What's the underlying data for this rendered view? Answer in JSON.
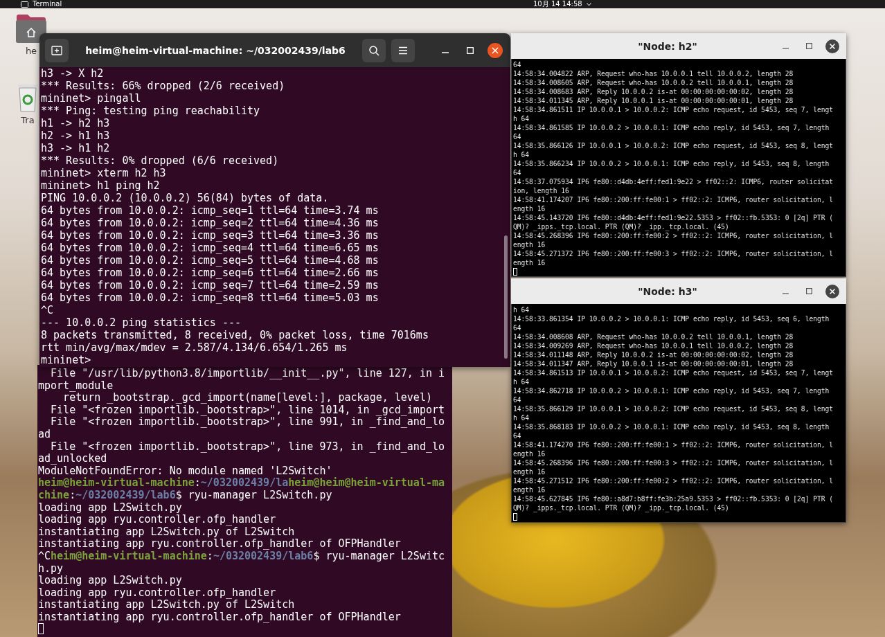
{
  "top_bar": {
    "app_menu": "Terminal",
    "clock": "10月 14 14:58"
  },
  "desktop_icons": [
    {
      "kind": "home",
      "label": "he"
    },
    {
      "kind": "trash",
      "label": "Tra"
    }
  ],
  "main_terminal": {
    "title": "heim@heim-virtual-machine: ~/032002439/lab6",
    "lines": [
      "h3 -> X h2",
      "*** Results: 66% dropped (2/6 received)",
      "mininet> pingall",
      "*** Ping: testing ping reachability",
      "h1 -> h2 h3",
      "h2 -> h1 h3",
      "h3 -> h1 h2",
      "*** Results: 0% dropped (6/6 received)",
      "mininet> xterm h2 h3",
      "mininet> h1 ping h2",
      "PING 10.0.0.2 (10.0.0.2) 56(84) bytes of data.",
      "64 bytes from 10.0.0.2: icmp_seq=1 ttl=64 time=3.74 ms",
      "64 bytes from 10.0.0.2: icmp_seq=2 ttl=64 time=4.36 ms",
      "64 bytes from 10.0.0.2: icmp_seq=3 ttl=64 time=3.36 ms",
      "64 bytes from 10.0.0.2: icmp_seq=4 ttl=64 time=6.65 ms",
      "64 bytes from 10.0.0.2: icmp_seq=5 ttl=64 time=4.68 ms",
      "64 bytes from 10.0.0.2: icmp_seq=6 ttl=64 time=2.66 ms",
      "64 bytes from 10.0.0.2: icmp_seq=7 ttl=64 time=2.59 ms",
      "64 bytes from 10.0.0.2: icmp_seq=8 ttl=64 time=5.03 ms",
      "^C",
      "--- 10.0.0.2 ping statistics ---",
      "8 packets transmitted, 8 received, 0% packet loss, time 7016ms",
      "rtt min/avg/max/mdev = 2.587/4.134/6.654/1.265 ms",
      "mininet>"
    ]
  },
  "back_terminal": {
    "lines": [
      [
        {
          "kind": "text",
          "text": "  File \"/usr/lib/python3.8/importlib/__init__.py\", line 127, in i"
        }
      ],
      [
        {
          "kind": "text",
          "text": "mport_module"
        }
      ],
      [
        {
          "kind": "text",
          "text": "    return _bootstrap._gcd_import(name[level:], package, level)"
        }
      ],
      [
        {
          "kind": "text",
          "text": "  File \"<frozen importlib._bootstrap>\", line 1014, in _gcd_import"
        }
      ],
      [
        {
          "kind": "text",
          "text": "  File \"<frozen importlib._bootstrap>\", line 991, in _find_and_lo"
        }
      ],
      [
        {
          "kind": "text",
          "text": "ad"
        }
      ],
      [
        {
          "kind": "text",
          "text": "  File \"<frozen importlib._bootstrap>\", line 973, in _find_and_lo"
        }
      ],
      [
        {
          "kind": "text",
          "text": "ad_unlocked"
        }
      ],
      [
        {
          "kind": "text",
          "text": "ModuleNotFoundError: No module named 'L2Switch'"
        }
      ],
      [
        {
          "kind": "user",
          "text": "heim@heim-virtual-machine"
        },
        {
          "kind": "text",
          "text": ":"
        },
        {
          "kind": "path",
          "text": "~/032002439/la"
        },
        {
          "kind": "user",
          "text": "heim@heim@heim-virtual-ma"
        }
      ],
      [
        {
          "kind": "user",
          "text": "chine"
        },
        {
          "kind": "text",
          "text": ":"
        },
        {
          "kind": "path",
          "text": "~/032002439/lab6"
        },
        {
          "kind": "text",
          "text": "$ ryu-manager L2Switch.py"
        }
      ],
      [
        {
          "kind": "text",
          "text": "loading app L2Switch.py"
        }
      ],
      [
        {
          "kind": "text",
          "text": "loading app ryu.controller.ofp_handler"
        }
      ],
      [
        {
          "kind": "text",
          "text": "instantiating app L2Switch.py of L2Switch"
        }
      ],
      [
        {
          "kind": "text",
          "text": "instantiating app ryu.controller.ofp_handler of OFPHandler"
        }
      ],
      [
        {
          "kind": "text",
          "text": "^C"
        },
        {
          "kind": "user",
          "text": "heim@heim-virtual-machine"
        },
        {
          "kind": "text",
          "text": ":"
        },
        {
          "kind": "path",
          "text": "~/032002439/lab6"
        },
        {
          "kind": "text",
          "text": "$ ryu-manager L2Switc"
        }
      ],
      [
        {
          "kind": "text",
          "text": "h.py"
        }
      ],
      [
        {
          "kind": "text",
          "text": "loading app L2Switch.py"
        }
      ],
      [
        {
          "kind": "text",
          "text": "loading app ryu.controller.ofp_handler"
        }
      ],
      [
        {
          "kind": "text",
          "text": "instantiating app L2Switch.py of L2Switch"
        }
      ],
      [
        {
          "kind": "text",
          "text": "instantiating app ryu.controller.ofp_handler of OFPHandler"
        }
      ]
    ]
  },
  "xterms": [
    {
      "title": "\"Node: h2\"",
      "lines": [
        "64",
        "14:58:34.004822 ARP, Request who-has 10.0.0.1 tell 10.0.0.2, length 28",
        "14:58:34.008605 ARP, Request who-has 10.0.0.2 tell 10.0.0.1, length 28",
        "14:58:34.008683 ARP, Reply 10.0.0.2 is-at 00:00:00:00:00:02, length 28",
        "14:58:34.011345 ARP, Reply 10.0.0.1 is-at 00:00:00:00:00:01, length 28",
        "14:58:34.861511 IP 10.0.0.1 > 10.0.0.2: ICMP echo request, id 5453, seq 7, lengt",
        "h 64",
        "14:58:34.861585 IP 10.0.0.2 > 10.0.0.1: ICMP echo reply, id 5453, seq 7, length",
        "64",
        "14:58:35.866126 IP 10.0.0.1 > 10.0.0.2: ICMP echo request, id 5453, seq 8, lengt",
        "h 64",
        "14:58:35.866234 IP 10.0.0.2 > 10.0.0.1: ICMP echo reply, id 5453, seq 8, length",
        "64",
        "14:58:37.075934 IP6 fe80::d4db:4eff:fed1:9e22 > ff02::2: ICMP6, router solicitat",
        "ion, length 16",
        "14:58:41.174207 IP6 fe80::200:ff:fe00:1 > ff02::2: ICMP6, router solicitation, l",
        "ength 16",
        "14:58:45.143720 IP6 fe80::d4db:4eff:fed1:9e22.5353 > ff02::fb.5353: 0 [2q] PTR (",
        "QM)? _ipps._tcp.local. PTR (QM)? _ipp._tcp.local. (45)",
        "14:58:45.268396 IP6 fe80::200:ff:fe00:2 > ff02::2: ICMP6, router solicitation, l",
        "ength 16",
        "14:58:45.271372 IP6 fe80::200:ff:fe00:3 > ff02::2: ICMP6, router solicitation, l",
        "ength 16"
      ]
    },
    {
      "title": "\"Node: h3\"",
      "lines": [
        "h 64",
        "14:58:33.861354 IP 10.0.0.2 > 10.0.0.1: ICMP echo reply, id 5453, seq 6, length",
        "64",
        "14:58:34.008608 ARP, Request who-has 10.0.0.2 tell 10.0.0.1, length 28",
        "14:58:34.009269 ARP, Request who-has 10.0.0.1 tell 10.0.0.2, length 28",
        "14:58:34.011148 ARP, Reply 10.0.0.2 is-at 00:00:00:00:00:02, length 28",
        "14:58:34.011347 ARP, Reply 10.0.0.1 is-at 00:00:00:00:00:01, length 28",
        "14:58:34.861513 IP 10.0.0.1 > 10.0.0.2: ICMP echo request, id 5453, seq 7, lengt",
        "h 64",
        "14:58:34.862718 IP 10.0.0.2 > 10.0.0.1: ICMP echo reply, id 5453, seq 7, length",
        "64",
        "14:58:35.866129 IP 10.0.0.1 > 10.0.0.2: ICMP echo request, id 5453, seq 8, lengt",
        "h 64",
        "14:58:35.868183 IP 10.0.0.2 > 10.0.0.1: ICMP echo reply, id 5453, seq 8, length",
        "64",
        "14:58:41.174270 IP6 fe80::200:ff:fe00:1 > ff02::2: ICMP6, router solicitation, l",
        "ength 16",
        "14:58:45.268396 IP6 fe80::200:ff:fe00:3 > ff02::2: ICMP6, router solicitation, l",
        "ength 16",
        "14:58:45.271512 IP6 fe80::200:ff:fe00:2 > ff02::2: ICMP6, router solicitation, l",
        "ength 16",
        "14:58:45.627845 IP6 fe80::a8d7:b8ff:fe3b:25a9.5353 > ff02::fb.5353: 0 [2q] PTR (",
        "QM)? _ipps._tcp.local. PTR (QM)? _ipp._tcp.local. (45)"
      ]
    }
  ]
}
